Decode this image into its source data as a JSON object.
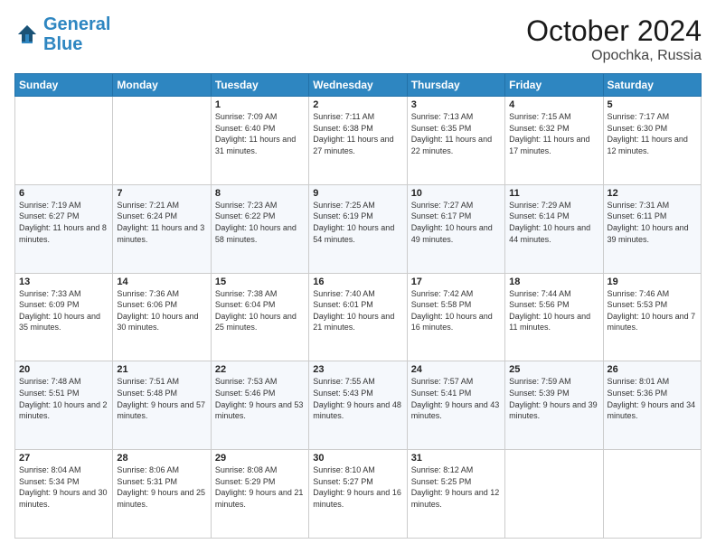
{
  "header": {
    "logo_line1": "General",
    "logo_line2": "Blue",
    "month": "October 2024",
    "location": "Opochka, Russia"
  },
  "days_of_week": [
    "Sunday",
    "Monday",
    "Tuesday",
    "Wednesday",
    "Thursday",
    "Friday",
    "Saturday"
  ],
  "weeks": [
    [
      {
        "day": "",
        "sunrise": "",
        "sunset": "",
        "daylight": ""
      },
      {
        "day": "",
        "sunrise": "",
        "sunset": "",
        "daylight": ""
      },
      {
        "day": "1",
        "sunrise": "Sunrise: 7:09 AM",
        "sunset": "Sunset: 6:40 PM",
        "daylight": "Daylight: 11 hours and 31 minutes."
      },
      {
        "day": "2",
        "sunrise": "Sunrise: 7:11 AM",
        "sunset": "Sunset: 6:38 PM",
        "daylight": "Daylight: 11 hours and 27 minutes."
      },
      {
        "day": "3",
        "sunrise": "Sunrise: 7:13 AM",
        "sunset": "Sunset: 6:35 PM",
        "daylight": "Daylight: 11 hours and 22 minutes."
      },
      {
        "day": "4",
        "sunrise": "Sunrise: 7:15 AM",
        "sunset": "Sunset: 6:32 PM",
        "daylight": "Daylight: 11 hours and 17 minutes."
      },
      {
        "day": "5",
        "sunrise": "Sunrise: 7:17 AM",
        "sunset": "Sunset: 6:30 PM",
        "daylight": "Daylight: 11 hours and 12 minutes."
      }
    ],
    [
      {
        "day": "6",
        "sunrise": "Sunrise: 7:19 AM",
        "sunset": "Sunset: 6:27 PM",
        "daylight": "Daylight: 11 hours and 8 minutes."
      },
      {
        "day": "7",
        "sunrise": "Sunrise: 7:21 AM",
        "sunset": "Sunset: 6:24 PM",
        "daylight": "Daylight: 11 hours and 3 minutes."
      },
      {
        "day": "8",
        "sunrise": "Sunrise: 7:23 AM",
        "sunset": "Sunset: 6:22 PM",
        "daylight": "Daylight: 10 hours and 58 minutes."
      },
      {
        "day": "9",
        "sunrise": "Sunrise: 7:25 AM",
        "sunset": "Sunset: 6:19 PM",
        "daylight": "Daylight: 10 hours and 54 minutes."
      },
      {
        "day": "10",
        "sunrise": "Sunrise: 7:27 AM",
        "sunset": "Sunset: 6:17 PM",
        "daylight": "Daylight: 10 hours and 49 minutes."
      },
      {
        "day": "11",
        "sunrise": "Sunrise: 7:29 AM",
        "sunset": "Sunset: 6:14 PM",
        "daylight": "Daylight: 10 hours and 44 minutes."
      },
      {
        "day": "12",
        "sunrise": "Sunrise: 7:31 AM",
        "sunset": "Sunset: 6:11 PM",
        "daylight": "Daylight: 10 hours and 39 minutes."
      }
    ],
    [
      {
        "day": "13",
        "sunrise": "Sunrise: 7:33 AM",
        "sunset": "Sunset: 6:09 PM",
        "daylight": "Daylight: 10 hours and 35 minutes."
      },
      {
        "day": "14",
        "sunrise": "Sunrise: 7:36 AM",
        "sunset": "Sunset: 6:06 PM",
        "daylight": "Daylight: 10 hours and 30 minutes."
      },
      {
        "day": "15",
        "sunrise": "Sunrise: 7:38 AM",
        "sunset": "Sunset: 6:04 PM",
        "daylight": "Daylight: 10 hours and 25 minutes."
      },
      {
        "day": "16",
        "sunrise": "Sunrise: 7:40 AM",
        "sunset": "Sunset: 6:01 PM",
        "daylight": "Daylight: 10 hours and 21 minutes."
      },
      {
        "day": "17",
        "sunrise": "Sunrise: 7:42 AM",
        "sunset": "Sunset: 5:58 PM",
        "daylight": "Daylight: 10 hours and 16 minutes."
      },
      {
        "day": "18",
        "sunrise": "Sunrise: 7:44 AM",
        "sunset": "Sunset: 5:56 PM",
        "daylight": "Daylight: 10 hours and 11 minutes."
      },
      {
        "day": "19",
        "sunrise": "Sunrise: 7:46 AM",
        "sunset": "Sunset: 5:53 PM",
        "daylight": "Daylight: 10 hours and 7 minutes."
      }
    ],
    [
      {
        "day": "20",
        "sunrise": "Sunrise: 7:48 AM",
        "sunset": "Sunset: 5:51 PM",
        "daylight": "Daylight: 10 hours and 2 minutes."
      },
      {
        "day": "21",
        "sunrise": "Sunrise: 7:51 AM",
        "sunset": "Sunset: 5:48 PM",
        "daylight": "Daylight: 9 hours and 57 minutes."
      },
      {
        "day": "22",
        "sunrise": "Sunrise: 7:53 AM",
        "sunset": "Sunset: 5:46 PM",
        "daylight": "Daylight: 9 hours and 53 minutes."
      },
      {
        "day": "23",
        "sunrise": "Sunrise: 7:55 AM",
        "sunset": "Sunset: 5:43 PM",
        "daylight": "Daylight: 9 hours and 48 minutes."
      },
      {
        "day": "24",
        "sunrise": "Sunrise: 7:57 AM",
        "sunset": "Sunset: 5:41 PM",
        "daylight": "Daylight: 9 hours and 43 minutes."
      },
      {
        "day": "25",
        "sunrise": "Sunrise: 7:59 AM",
        "sunset": "Sunset: 5:39 PM",
        "daylight": "Daylight: 9 hours and 39 minutes."
      },
      {
        "day": "26",
        "sunrise": "Sunrise: 8:01 AM",
        "sunset": "Sunset: 5:36 PM",
        "daylight": "Daylight: 9 hours and 34 minutes."
      }
    ],
    [
      {
        "day": "27",
        "sunrise": "Sunrise: 8:04 AM",
        "sunset": "Sunset: 5:34 PM",
        "daylight": "Daylight: 9 hours and 30 minutes."
      },
      {
        "day": "28",
        "sunrise": "Sunrise: 8:06 AM",
        "sunset": "Sunset: 5:31 PM",
        "daylight": "Daylight: 9 hours and 25 minutes."
      },
      {
        "day": "29",
        "sunrise": "Sunrise: 8:08 AM",
        "sunset": "Sunset: 5:29 PM",
        "daylight": "Daylight: 9 hours and 21 minutes."
      },
      {
        "day": "30",
        "sunrise": "Sunrise: 8:10 AM",
        "sunset": "Sunset: 5:27 PM",
        "daylight": "Daylight: 9 hours and 16 minutes."
      },
      {
        "day": "31",
        "sunrise": "Sunrise: 8:12 AM",
        "sunset": "Sunset: 5:25 PM",
        "daylight": "Daylight: 9 hours and 12 minutes."
      },
      {
        "day": "",
        "sunrise": "",
        "sunset": "",
        "daylight": ""
      },
      {
        "day": "",
        "sunrise": "",
        "sunset": "",
        "daylight": ""
      }
    ]
  ]
}
